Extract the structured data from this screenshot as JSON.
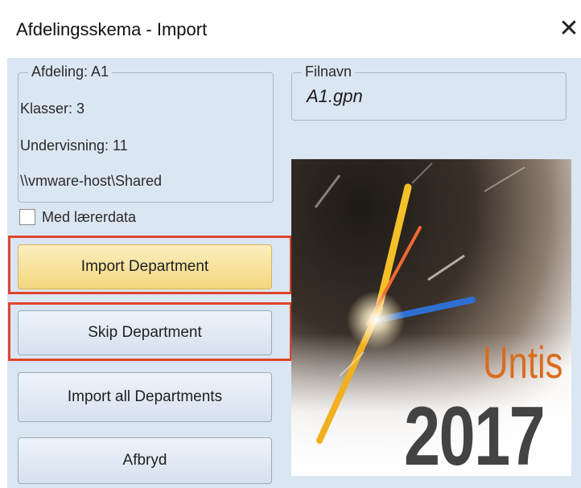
{
  "window": {
    "title": "Afdelingsskema - Import",
    "close_glyph": "✕"
  },
  "department_group": {
    "legend": "Afdeling: A1",
    "lines": [
      "Klasser: 3",
      "Undervisning: 11",
      "\\\\vmware-host\\Shared"
    ]
  },
  "file_group": {
    "legend": "Filnavn",
    "value": "A1.gpn"
  },
  "checkbox": {
    "label": "Med lærerdata",
    "checked": false
  },
  "buttons": {
    "import_department": "Import Department",
    "skip_department": "Skip Department",
    "import_all": "Import all Departments",
    "cancel": "Afbryd"
  },
  "splash": {
    "brand": "Untis",
    "year": "2017",
    "brand_color": "#d86c1f",
    "year_color": "#434343"
  },
  "colors": {
    "highlight": "#e0442a",
    "dialog_background": "#dbe6f3",
    "primary_button": "#f3d77e"
  }
}
